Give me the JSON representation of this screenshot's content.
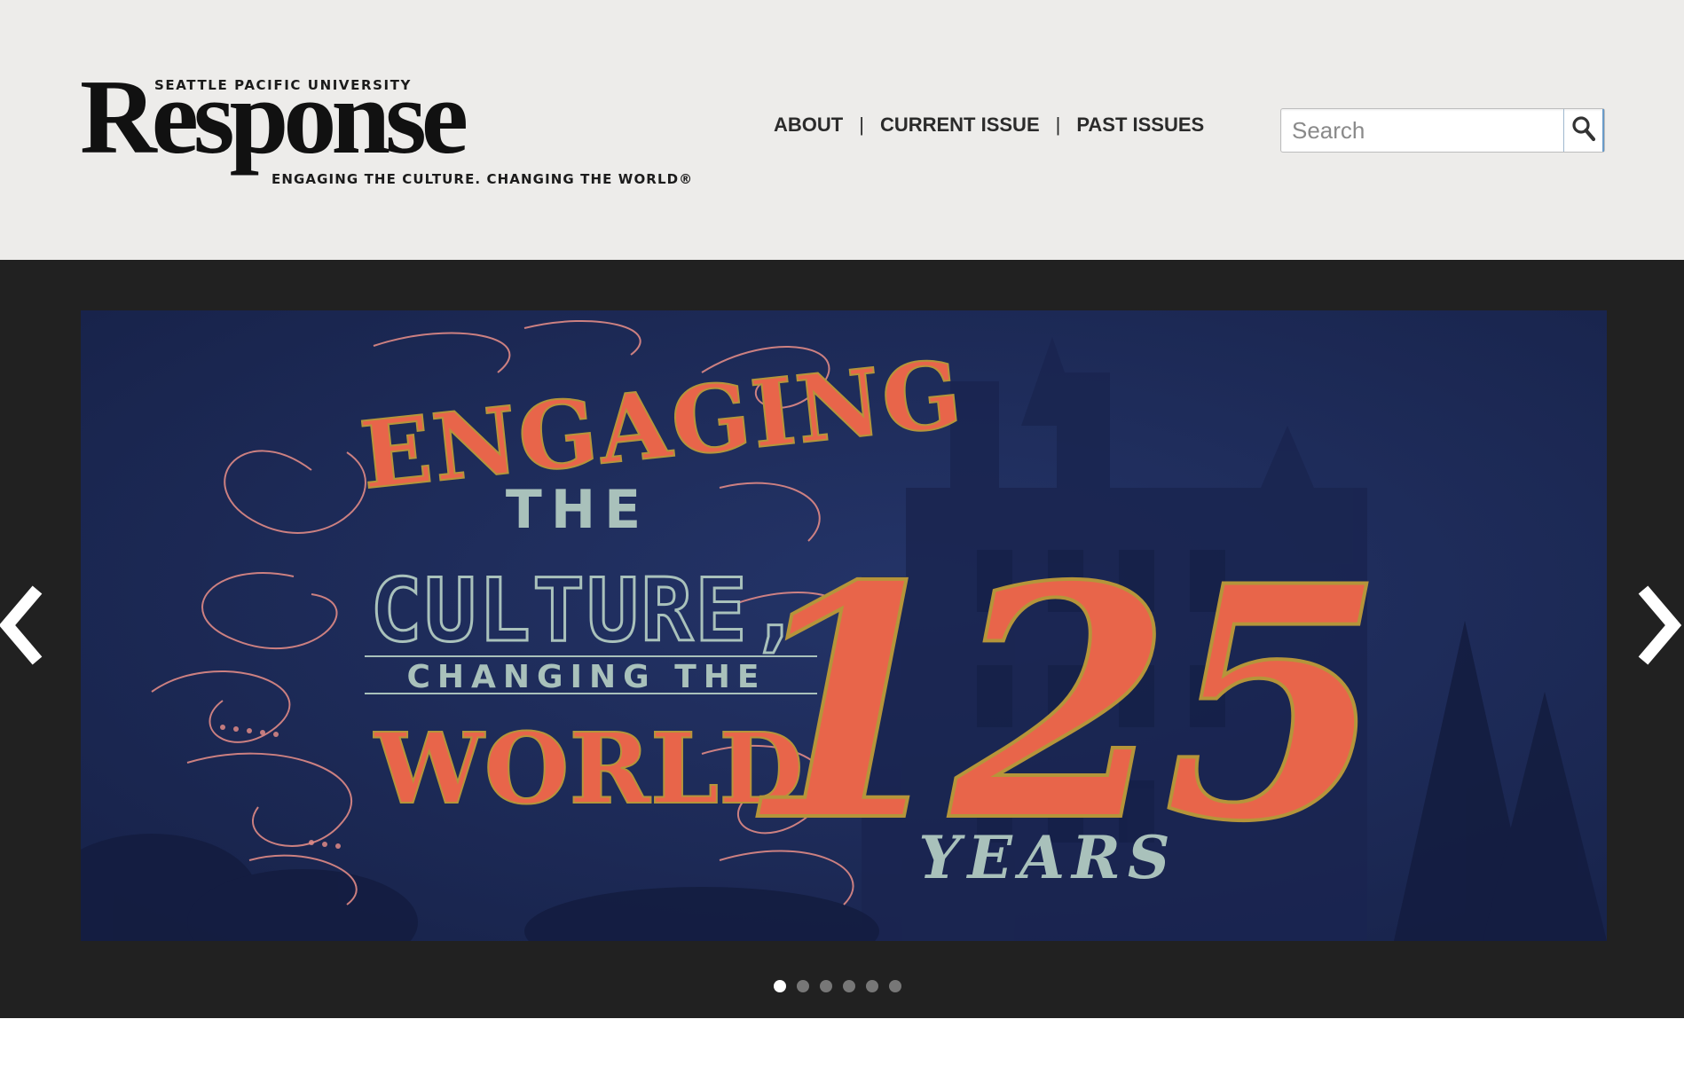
{
  "logo": {
    "kicker": "SEATTLE PACIFIC UNIVERSITY",
    "wordmark": "Response",
    "tagline": "ENGAGING THE CULTURE. CHANGING THE WORLD®"
  },
  "nav": {
    "items": [
      {
        "label": "ABOUT"
      },
      {
        "label": "CURRENT ISSUE"
      },
      {
        "label": "PAST ISSUES"
      }
    ],
    "separator": "|"
  },
  "search": {
    "placeholder": "Search",
    "value": "",
    "icon": "search-icon"
  },
  "hero": {
    "line1": "ENGAGING",
    "line2": "THE",
    "line3": "CULTURE,",
    "line4": "CHANGING THE",
    "line5": "WORLD.",
    "number": "125",
    "years": "YEARS",
    "prev_icon": "chevron-left-icon",
    "next_icon": "chevron-right-icon",
    "slide_count": 6,
    "active_slide": 1
  },
  "colors": {
    "header_bg": "#edecea",
    "slider_bg": "#212121",
    "slide_bg": "#1e2b5c",
    "accent_orange": "#e8654a",
    "accent_gold": "#b5953a",
    "teal_text": "#a9c1bb",
    "pink_flourish": "#e08a86"
  }
}
